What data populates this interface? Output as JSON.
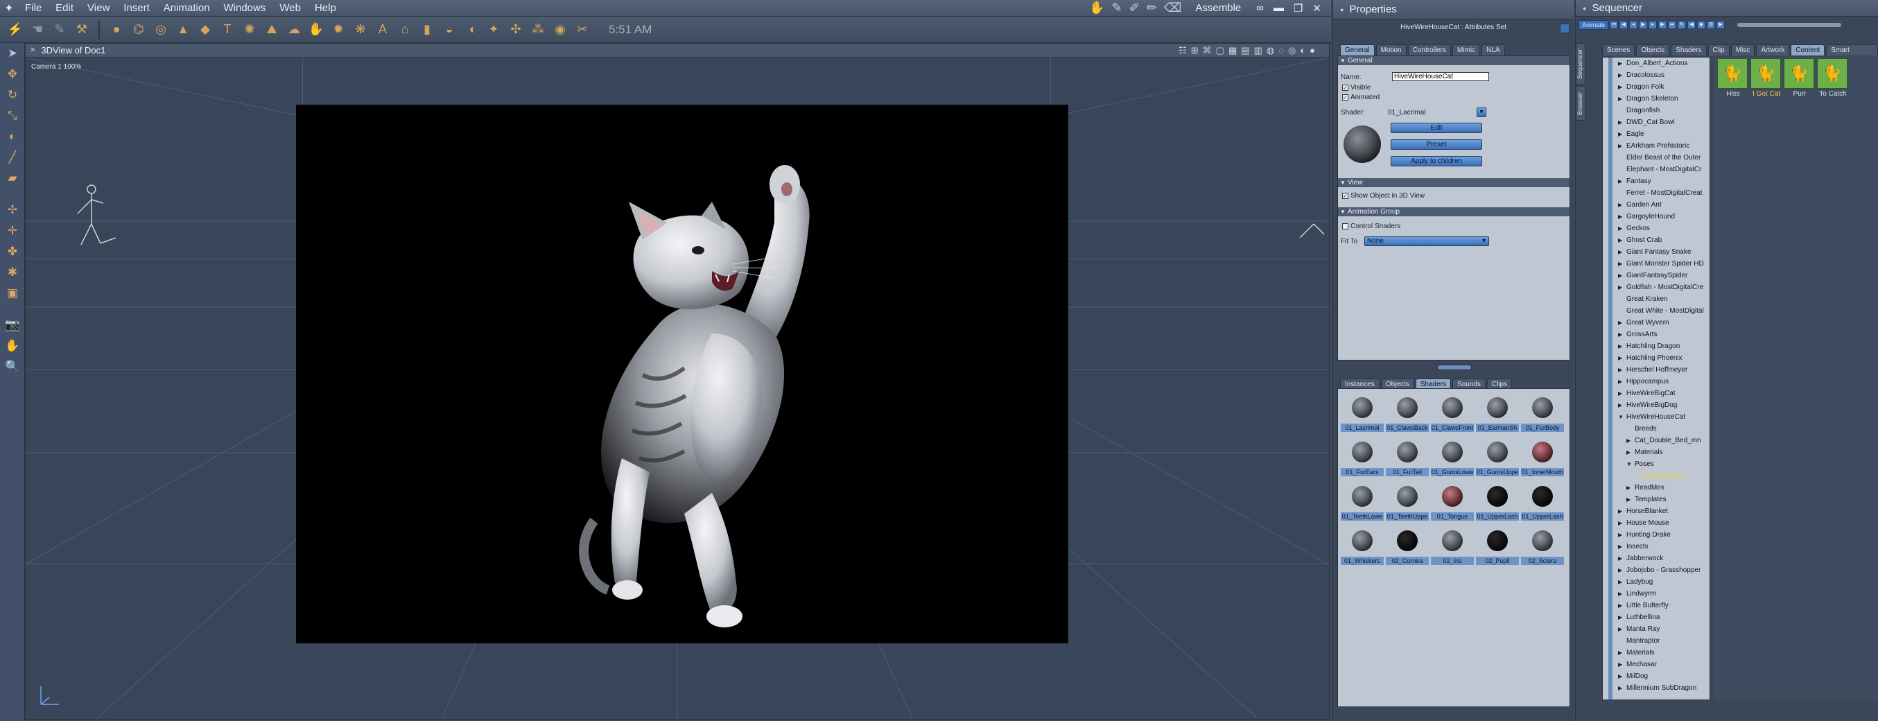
{
  "menubar": {
    "items": [
      "File",
      "Edit",
      "View",
      "Insert",
      "Animation",
      "Windows",
      "Web",
      "Help"
    ],
    "room_name": "Assemble"
  },
  "toolbar": {
    "clock": "5:51 AM"
  },
  "view3d": {
    "title": "3DView of Doc1",
    "camera_label": "Camera 1 100%"
  },
  "properties": {
    "title": "Properties",
    "subtitle": "HiveWireHouseCat : Attributes Set",
    "tabs": [
      "General",
      "Motion",
      "Controllers",
      "Mimic",
      "NLA"
    ],
    "sections": {
      "general": "General",
      "view": "View",
      "animation_group": "Animation Group"
    },
    "name_label": "Name:",
    "name_value": "HiveWireHouseCat",
    "visible_label": "Visible",
    "animated_label": "Animated",
    "shader_label": "Shader:",
    "shader_value": "01_Lacrimal",
    "edit_button": "Edit",
    "preset_button": "Preset",
    "apply_button": "Apply to children",
    "show_object_label": "Show Object in 3D View",
    "control_shaders_label": "Control Shaders",
    "fit_to_label": "Fit To",
    "fit_to_value": "None"
  },
  "library": {
    "tabs": [
      "Instances",
      "Objects",
      "Shaders",
      "Sounds",
      "Clips"
    ],
    "active_tab": "Shaders",
    "shaders": [
      {
        "name": "01_Lacrimal",
        "tone": "gray"
      },
      {
        "name": "01_ClawsBack",
        "tone": "gray"
      },
      {
        "name": "01_ClawsFront",
        "tone": "gray"
      },
      {
        "name": "01_EarHairSh",
        "tone": "gray"
      },
      {
        "name": "01_FurBody",
        "tone": "gray"
      },
      {
        "name": "01_FurEars",
        "tone": "gray"
      },
      {
        "name": "01_FurTail",
        "tone": "gray"
      },
      {
        "name": "01_GumsLowe",
        "tone": "gray"
      },
      {
        "name": "01_GumsUppe",
        "tone": "gray"
      },
      {
        "name": "01_InnerMouth",
        "tone": "red"
      },
      {
        "name": "01_TeethLowe",
        "tone": "gray"
      },
      {
        "name": "01_TeethUppe",
        "tone": "gray"
      },
      {
        "name": "01_Tongue",
        "tone": "red"
      },
      {
        "name": "01_UpperLash",
        "tone": "black"
      },
      {
        "name": "01_UpperLash",
        "tone": "black"
      },
      {
        "name": "01_Whiskers",
        "tone": "gray"
      },
      {
        "name": "02_Cornea",
        "tone": "black"
      },
      {
        "name": "02_Iris",
        "tone": "gray"
      },
      {
        "name": "02_Pupil",
        "tone": "black"
      },
      {
        "name": "02_Sclera",
        "tone": "gray"
      }
    ]
  },
  "sequencer": {
    "title": "Sequencer",
    "animate_button": "Animate",
    "side_tabs": [
      "Sequencer",
      "Browser"
    ],
    "browser_tabs": [
      "Scenes",
      "Objects",
      "Shaders",
      "Clip",
      "Misc",
      "Artwork",
      "Content",
      "Smart Content"
    ],
    "active_browser_tab": "Content",
    "tree": [
      {
        "label": "Don_Albert_Actions",
        "level": 0,
        "arrow": true
      },
      {
        "label": "Dracolossus",
        "level": 0,
        "arrow": true
      },
      {
        "label": "Dragon Folk",
        "level": 0,
        "arrow": true
      },
      {
        "label": "Dragon Skeleton",
        "level": 0,
        "arrow": true
      },
      {
        "label": "Dragonfish",
        "level": 0,
        "arrow": false
      },
      {
        "label": "DWD_Cat Bowl",
        "level": 0,
        "arrow": true
      },
      {
        "label": "Eagle",
        "level": 0,
        "arrow": true
      },
      {
        "label": "EArkham Prehistoric",
        "level": 0,
        "arrow": true
      },
      {
        "label": "Elder Beast of the Outer",
        "level": 0,
        "arrow": false
      },
      {
        "label": "Elephant - MostDigitalCr",
        "level": 0,
        "arrow": false
      },
      {
        "label": "Fantasy",
        "level": 0,
        "arrow": true
      },
      {
        "label": "Ferret - MostDigitalCreat",
        "level": 0,
        "arrow": false
      },
      {
        "label": "Garden Ant",
        "level": 0,
        "arrow": true
      },
      {
        "label": "GargoyleHound",
        "level": 0,
        "arrow": true
      },
      {
        "label": "Geckos",
        "level": 0,
        "arrow": true
      },
      {
        "label": "Ghost Crab",
        "level": 0,
        "arrow": true
      },
      {
        "label": "Giant Fantasy Snake",
        "level": 0,
        "arrow": true
      },
      {
        "label": "Giant Monster Spider HD",
        "level": 0,
        "arrow": true
      },
      {
        "label": "GiantFantasySpider",
        "level": 0,
        "arrow": true
      },
      {
        "label": "Goldfish - MostDigitalCre",
        "level": 0,
        "arrow": true
      },
      {
        "label": "Great Kraken",
        "level": 0,
        "arrow": false
      },
      {
        "label": "Great White - MostDigital",
        "level": 0,
        "arrow": false
      },
      {
        "label": "Great Wyvern",
        "level": 0,
        "arrow": true
      },
      {
        "label": "GrossArts",
        "level": 0,
        "arrow": true
      },
      {
        "label": "Hatchling Dragon",
        "level": 0,
        "arrow": true
      },
      {
        "label": "Hatchling Phoenix",
        "level": 0,
        "arrow": true
      },
      {
        "label": "Herschel Hoffmeyer",
        "level": 0,
        "arrow": true
      },
      {
        "label": "Hippocampus",
        "level": 0,
        "arrow": true
      },
      {
        "label": "HiveWireBigCat",
        "level": 0,
        "arrow": true
      },
      {
        "label": "HiveWireBigDog",
        "level": 0,
        "arrow": true
      },
      {
        "label": "HiveWireHouseCat",
        "level": 0,
        "arrow": true,
        "open": true
      },
      {
        "label": "Breeds",
        "level": 1,
        "arrow": false
      },
      {
        "label": "Cat_Double_Bed_mn",
        "level": 1,
        "arrow": true
      },
      {
        "label": "Materials",
        "level": 1,
        "arrow": true
      },
      {
        "label": "Poses",
        "level": 1,
        "arrow": true,
        "open": true
      },
      {
        "label": "PreyrStringset",
        "level": 2,
        "arrow": false,
        "selected": true
      },
      {
        "label": "ReadMes",
        "level": 1,
        "arrow": true
      },
      {
        "label": "Templates",
        "level": 1,
        "arrow": true
      },
      {
        "label": "HorseBlanket",
        "level": 0,
        "arrow": true
      },
      {
        "label": "House Mouse",
        "level": 0,
        "arrow": true
      },
      {
        "label": "Hunting Drake",
        "level": 0,
        "arrow": true
      },
      {
        "label": "Insects",
        "level": 0,
        "arrow": true
      },
      {
        "label": "Jabberwock",
        "level": 0,
        "arrow": true
      },
      {
        "label": "Jobojobo - Grasshopper",
        "level": 0,
        "arrow": true
      },
      {
        "label": "Ladybug",
        "level": 0,
        "arrow": true
      },
      {
        "label": "Lindwyrm",
        "level": 0,
        "arrow": true
      },
      {
        "label": "Little Butterfly",
        "level": 0,
        "arrow": true
      },
      {
        "label": "Luthbellina",
        "level": 0,
        "arrow": true
      },
      {
        "label": "Manta Ray",
        "level": 0,
        "arrow": true
      },
      {
        "label": "Mantraptor",
        "level": 0,
        "arrow": false
      },
      {
        "label": "Materials",
        "level": 0,
        "arrow": true
      },
      {
        "label": "Mechasar",
        "level": 0,
        "arrow": true
      },
      {
        "label": "MilDog",
        "level": 0,
        "arrow": true
      },
      {
        "label": "Millennium SubDragon",
        "level": 0,
        "arrow": true
      }
    ],
    "poses": [
      {
        "label": "Hiss"
      },
      {
        "label": "I Got Cat",
        "selected": true
      },
      {
        "label": "Purr"
      },
      {
        "label": "To Catch"
      }
    ]
  }
}
